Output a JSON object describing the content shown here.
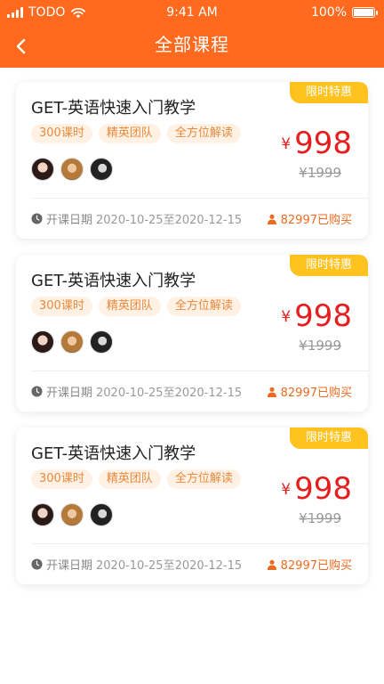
{
  "status_bar": {
    "carrier": "TODO",
    "time": "9:41 AM",
    "battery": "100%",
    "icons": [
      "signal-icon",
      "wifi-icon",
      "battery-icon"
    ]
  },
  "nav": {
    "title": "全部课程",
    "back_icon": "chevron-left-icon"
  },
  "colors": {
    "header": "#ff6a1f",
    "badge": "#ffc21f",
    "price": "#e61e1e",
    "tag_bg": "#fff1e3",
    "tag_text": "#e98a3e",
    "buyers": "#ee6a1f"
  },
  "courses": [
    {
      "badge": "限时特惠",
      "title": "GET-英语快速入门教学",
      "tags": [
        "300课时",
        "精英团队",
        "全方位解读"
      ],
      "currency": "¥",
      "price": "998",
      "original_price": "¥1999",
      "date_label": "开课日期",
      "date_range": "2020-10-25至2020-12-15",
      "buyers": "82997已购买"
    },
    {
      "badge": "限时特惠",
      "title": "GET-英语快速入门教学",
      "tags": [
        "300课时",
        "精英团队",
        "全方位解读"
      ],
      "currency": "¥",
      "price": "998",
      "original_price": "¥1999",
      "date_label": "开课日期",
      "date_range": "2020-10-25至2020-12-15",
      "buyers": "82997已购买"
    },
    {
      "badge": "限时特惠",
      "title": "GET-英语快速入门教学",
      "tags": [
        "300课时",
        "精英团队",
        "全方位解读"
      ],
      "currency": "¥",
      "price": "998",
      "original_price": "¥1999",
      "date_label": "开课日期",
      "date_range": "2020-10-25至2020-12-15",
      "buyers": "82997已购买"
    }
  ]
}
